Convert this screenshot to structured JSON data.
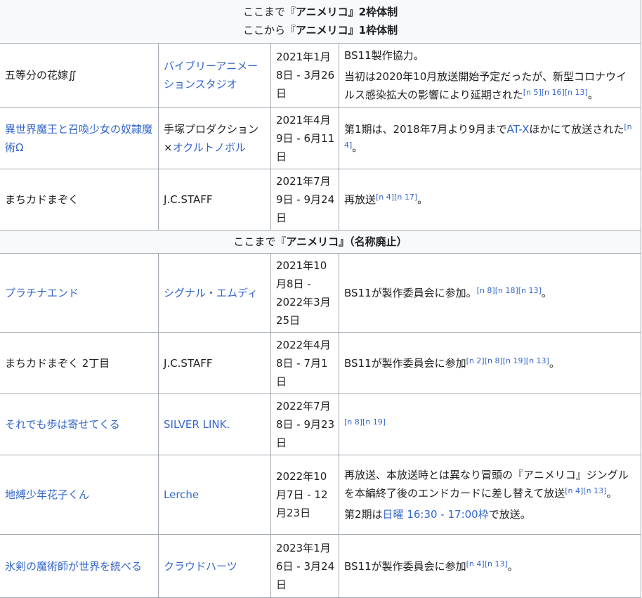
{
  "separators": {
    "until_2": {
      "pre": "ここまで『",
      "name": "アニメリコ",
      "post": "』2枠体制"
    },
    "from_1": {
      "pre": "ここから『",
      "name": "アニメリコ",
      "post": "』1枠体制"
    },
    "until_end": {
      "pre": "ここまで『",
      "name": "アニメリコ",
      "post": "』（名称廃止）"
    }
  },
  "rows": [
    {
      "title": "五等分の花嫁∬",
      "studio": "バイブリーアニメーションスタジオ",
      "date": "2021年1月8日 - 3月26日",
      "notes": [
        {
          "text": "BS11製作協力。"
        },
        {
          "text": "当初は2020年10月放送開始予定だったが、新型コロナウイルス感染拡大の影響により延期された",
          "refs": "[n 5][n 16][n 13]",
          "tail": "。"
        }
      ]
    },
    {
      "title": "異世界魔王と召喚少女の奴隷魔術Ω",
      "studio_plain": "手塚プロダクション×",
      "studio_link": "オクルトノボル",
      "date": "2021年4月9日 - 6月11日",
      "note_pre": "第1期は、2018年7月より9月まで",
      "note_link": "AT-X",
      "note_post": "ほかにて放送された",
      "refs": "[n 4]",
      "tail": "。"
    },
    {
      "title": "まちカドまぞく",
      "studio": "J.C.STAFF",
      "date": "2021年7月9日 - 9月24日",
      "note": "再放送",
      "refs": "[n 4][n 17]",
      "tail": "。"
    },
    {
      "title": "プラチナエンド",
      "studio": "シグナル・エムディ",
      "date": "2021年10月8日 - 2022年3月25日",
      "note": "BS11が製作委員会に参加。",
      "refs": "[n 8][n 18][n 13]",
      "tail": "。"
    },
    {
      "title": "まちカドまぞく 2丁目",
      "studio": "J.C.STAFF",
      "date": "2022年4月8日 - 7月1日",
      "note": "BS11が製作委員会に参加",
      "refs": "[n 2][n 8][n 19][n 13]",
      "tail": "。"
    },
    {
      "title": "それでも歩は寄せてくる",
      "studio": "SILVER LINK.",
      "date": "2022年7月8日 - 9月23日",
      "refs": "[n 8][n 19]"
    },
    {
      "title": "地縛少年花子くん",
      "studio": "Lerche",
      "date": "2022年10月7日 - 12月23日",
      "note1": "再放送、本放送時とは異なり冒頭の『アニメリコ』ジングルを本編終了後のエンドカードに差し替えて放送",
      "refs": "[n 4][n 13]",
      "tail": "。",
      "note2_pre": "第2期は",
      "note2_link": "日曜 16:30 - 17:00枠",
      "note2_post": "で放送。"
    },
    {
      "title": "氷剣の魔術師が世界を統べる",
      "studio": "クラウドハーツ",
      "date": "2023年1月6日 - 3月24日",
      "note": "BS11が製作委員会に参加",
      "refs": "[n 4][n 13]",
      "tail": "。"
    }
  ]
}
